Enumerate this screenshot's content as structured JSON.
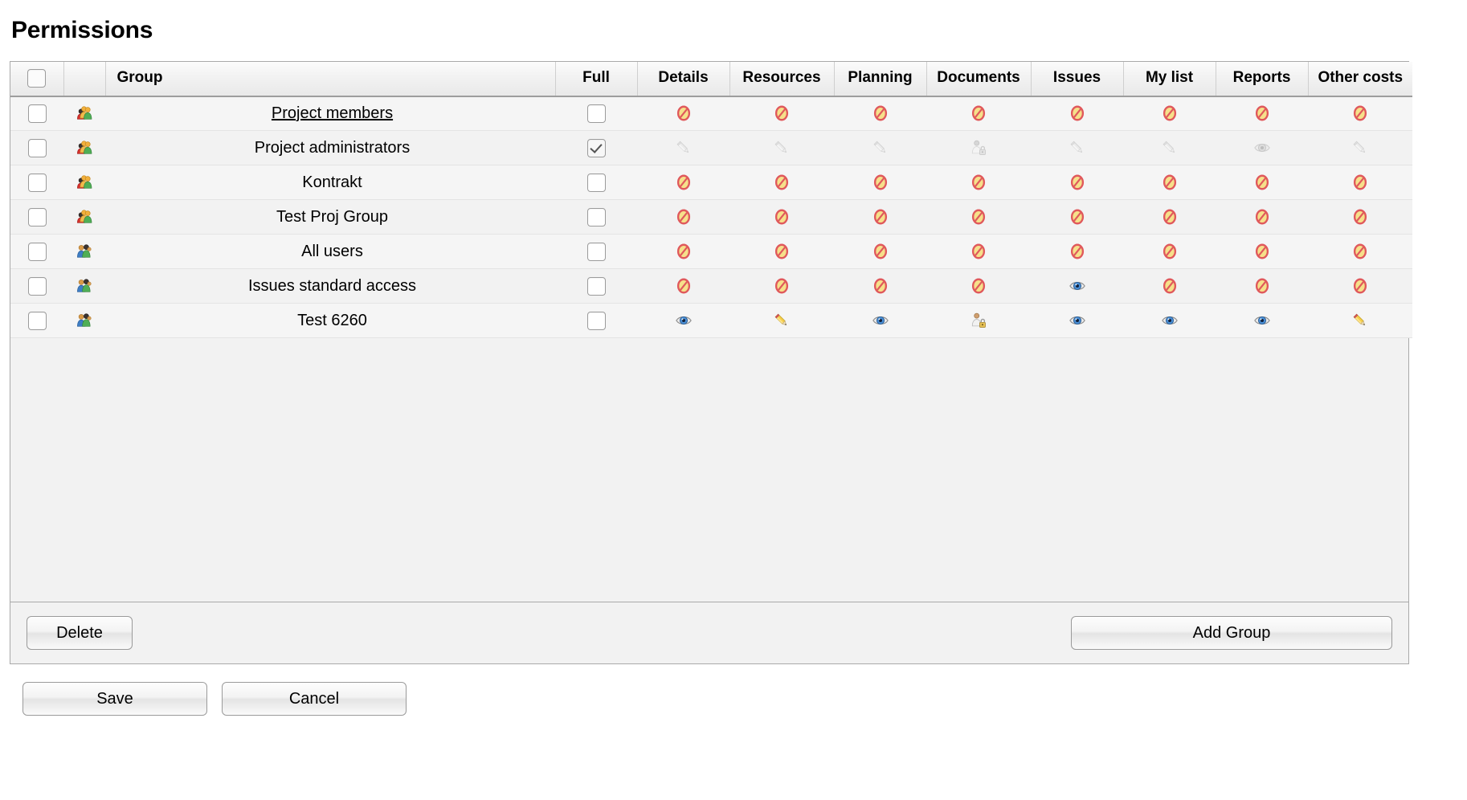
{
  "page": {
    "title": "Permissions"
  },
  "table": {
    "columns": [
      {
        "key": "select",
        "label": "",
        "type": "checkbox"
      },
      {
        "key": "groupicon",
        "label": "",
        "type": "icon"
      },
      {
        "key": "group",
        "label": "Group",
        "type": "text"
      },
      {
        "key": "full",
        "label": "Full",
        "type": "checkbox"
      },
      {
        "key": "details",
        "label": "Details",
        "type": "perm"
      },
      {
        "key": "resources",
        "label": "Resources",
        "type": "perm"
      },
      {
        "key": "planning",
        "label": "Planning",
        "type": "perm"
      },
      {
        "key": "documents",
        "label": "Documents",
        "type": "perm"
      },
      {
        "key": "issues",
        "label": "Issues",
        "type": "perm"
      },
      {
        "key": "mylist",
        "label": "My list",
        "type": "perm"
      },
      {
        "key": "reports",
        "label": "Reports",
        "type": "perm"
      },
      {
        "key": "othercosts",
        "label": "Other costs",
        "type": "perm"
      }
    ],
    "header_select_all": {
      "checked": false,
      "icon": "checkbox-icon"
    },
    "rows": [
      {
        "selected": false,
        "group_icon": "project-group-icon",
        "name": "Project members ",
        "link": true,
        "full": false,
        "full_disabled": false,
        "perms": [
          "denied-icon",
          "denied-icon",
          "denied-icon",
          "denied-icon",
          "denied-icon",
          "denied-icon",
          "denied-icon",
          "denied-icon"
        ]
      },
      {
        "selected": false,
        "group_icon": "project-group-icon",
        "name": "Project administrators",
        "link": false,
        "full": true,
        "full_disabled": true,
        "perms": [
          "pencil-disabled-icon",
          "pencil-disabled-icon",
          "pencil-disabled-icon",
          "person-lock-disabled-icon",
          "pencil-disabled-icon",
          "pencil-disabled-icon",
          "eye-disabled-icon",
          "pencil-disabled-icon"
        ]
      },
      {
        "selected": false,
        "group_icon": "project-group-icon",
        "name": "Kontrakt",
        "link": false,
        "full": false,
        "full_disabled": false,
        "perms": [
          "denied-icon",
          "denied-icon",
          "denied-icon",
          "denied-icon",
          "denied-icon",
          "denied-icon",
          "denied-icon",
          "denied-icon"
        ]
      },
      {
        "selected": false,
        "group_icon": "project-group-icon",
        "name": "Test Proj Group",
        "link": false,
        "full": false,
        "full_disabled": false,
        "perms": [
          "denied-icon",
          "denied-icon",
          "denied-icon",
          "denied-icon",
          "denied-icon",
          "denied-icon",
          "denied-icon",
          "denied-icon"
        ]
      },
      {
        "selected": false,
        "group_icon": "user-group-icon",
        "name": "All users",
        "link": false,
        "full": false,
        "full_disabled": false,
        "perms": [
          "denied-icon",
          "denied-icon",
          "denied-icon",
          "denied-icon",
          "denied-icon",
          "denied-icon",
          "denied-icon",
          "denied-icon"
        ]
      },
      {
        "selected": false,
        "group_icon": "user-group-icon",
        "name": "Issues standard access",
        "link": false,
        "full": false,
        "full_disabled": false,
        "perms": [
          "denied-icon",
          "denied-icon",
          "denied-icon",
          "denied-icon",
          "eye-icon",
          "denied-icon",
          "denied-icon",
          "denied-icon"
        ]
      },
      {
        "selected": false,
        "group_icon": "user-group-icon",
        "name": "Test 6260",
        "link": false,
        "full": false,
        "full_disabled": false,
        "perms": [
          "eye-icon",
          "pencil-icon",
          "eye-icon",
          "person-lock-icon",
          "eye-icon",
          "eye-icon",
          "eye-icon",
          "pencil-icon"
        ]
      }
    ]
  },
  "panel_footer": {
    "delete_label": "Delete",
    "add_group_label": "Add Group"
  },
  "bottom_bar": {
    "save_label": "Save",
    "cancel_label": "Cancel"
  },
  "colors": {
    "denied_red": "#e05c5c",
    "denied_yellow": "#f2d25a",
    "eye_blue": "#4a8fd6",
    "pencil_yellow": "#f5c636",
    "panel_bg": "#f2f2f2",
    "row_bg": "#f5f5f5",
    "border": "#a9a9a9"
  }
}
